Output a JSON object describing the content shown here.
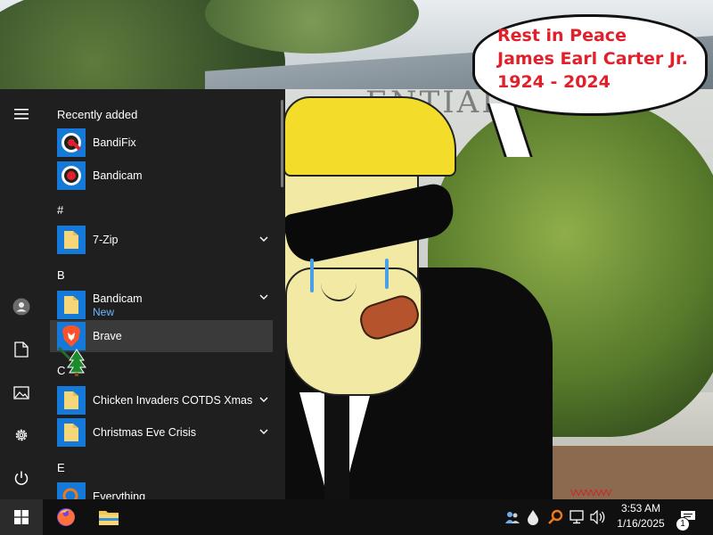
{
  "wallpaper": {
    "building_sign": "ENTIAL",
    "speech_lines": [
      "Rest in Peace",
      "James Earl Carter Jr.",
      "1924 - 2024"
    ],
    "scribble": "VVVVVVVV"
  },
  "start_menu": {
    "rail": {
      "menu_icon": "hamburger-icon",
      "items": [
        {
          "name": "user-account",
          "icon": "user-icon"
        },
        {
          "name": "documents",
          "icon": "document-icon"
        },
        {
          "name": "pictures",
          "icon": "picture-icon"
        },
        {
          "name": "settings",
          "icon": "gear-icon"
        },
        {
          "name": "power",
          "icon": "power-icon"
        }
      ]
    },
    "recently_added_title": "Recently added",
    "recent_apps": [
      {
        "label": "BandiFix",
        "icon": "bandifix-icon"
      },
      {
        "label": "Bandicam",
        "icon": "bandicam-icon"
      }
    ],
    "groups": [
      {
        "letter": "#",
        "apps": [
          {
            "label": "7-Zip",
            "icon": "folder-icon",
            "expandable": true
          }
        ]
      },
      {
        "letter": "B",
        "apps": [
          {
            "label": "Bandicam",
            "sub": "New",
            "icon": "folder-icon",
            "expandable": true
          },
          {
            "label": "Brave",
            "icon": "brave-icon",
            "highlighted": true
          }
        ]
      },
      {
        "letter": "C",
        "apps": [
          {
            "label": "Chicken Invaders COTDS Xmas",
            "icon": "folder-icon",
            "expandable": true
          },
          {
            "label": "Christmas Eve Crisis",
            "icon": "folder-icon",
            "expandable": true
          }
        ]
      },
      {
        "letter": "E",
        "apps": [
          {
            "label": "Everything",
            "icon": "everything-icon"
          }
        ]
      }
    ],
    "accent_color": "#1479d9"
  },
  "taskbar": {
    "start_icon": "windows-logo-icon",
    "pinned": [
      {
        "name": "firefox",
        "icon": "firefox-icon"
      },
      {
        "name": "file-explorer",
        "icon": "folder-icon"
      }
    ],
    "tray_icons": [
      "people-icon",
      "drop-icon",
      "search-key-icon",
      "network-icon",
      "volume-icon"
    ],
    "time": "3:53 AM",
    "date": "1/16/2025",
    "notification_count": "1"
  }
}
